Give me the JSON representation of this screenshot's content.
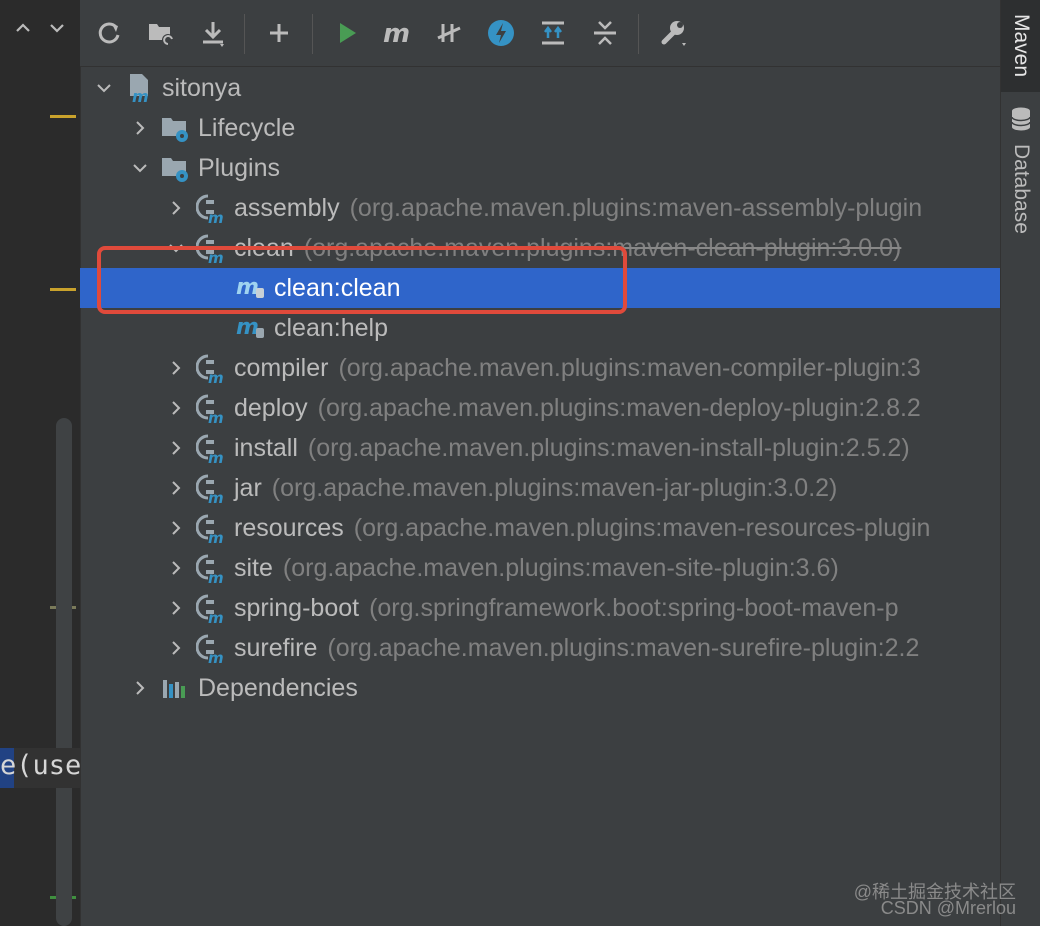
{
  "editor": {
    "code_fragment": "e(use",
    "nav_up_icon": "chevron-up-icon",
    "nav_down_icon": "chevron-down-icon"
  },
  "toolbar": {
    "buttons": [
      {
        "id": "reload",
        "icon": "reload-icon"
      },
      {
        "id": "generate-sources",
        "icon": "folder-refresh-icon"
      },
      {
        "id": "download",
        "icon": "download-icon"
      },
      {
        "id": "add",
        "icon": "plus-icon"
      },
      {
        "id": "run",
        "icon": "run-icon"
      },
      {
        "id": "execute-goal",
        "icon": "maven-m-icon"
      },
      {
        "id": "toggle-offline",
        "icon": "offline-toggle-icon"
      },
      {
        "id": "skip-tests",
        "icon": "lightning-icon"
      },
      {
        "id": "show-dependencies",
        "icon": "expand-all-icon"
      },
      {
        "id": "collapse-all",
        "icon": "collapse-all-icon"
      },
      {
        "id": "settings",
        "icon": "wrench-icon"
      }
    ]
  },
  "side_tabs": {
    "maven": "Maven",
    "database": "Database"
  },
  "tree": {
    "project": "sitonya",
    "lifecycle": "Lifecycle",
    "plugins": "Plugins",
    "plugin_items": [
      {
        "name": "assembly",
        "coord": "(org.apache.maven.plugins:maven-assembly-plugin"
      },
      {
        "name": "clean",
        "coord": "(org.apache.maven.plugins:maven-clean-plugin:3.0.0)"
      },
      {
        "name": "compiler",
        "coord": "(org.apache.maven.plugins:maven-compiler-plugin:3"
      },
      {
        "name": "deploy",
        "coord": "(org.apache.maven.plugins:maven-deploy-plugin:2.8.2"
      },
      {
        "name": "install",
        "coord": "(org.apache.maven.plugins:maven-install-plugin:2.5.2)"
      },
      {
        "name": "jar",
        "coord": "(org.apache.maven.plugins:maven-jar-plugin:3.0.2)"
      },
      {
        "name": "resources",
        "coord": "(org.apache.maven.plugins:maven-resources-plugin"
      },
      {
        "name": "site",
        "coord": "(org.apache.maven.plugins:maven-site-plugin:3.6)"
      },
      {
        "name": "spring-boot",
        "coord": "(org.springframework.boot:spring-boot-maven-p"
      },
      {
        "name": "surefire",
        "coord": "(org.apache.maven.plugins:maven-surefire-plugin:2.2"
      }
    ],
    "clean_goals": [
      "clean:clean",
      "clean:help"
    ],
    "dependencies": "Dependencies"
  },
  "watermark": {
    "line1": "@稀土掘金技术社区",
    "line2": "CSDN @Mrerlou"
  },
  "colors": {
    "selection": "#2f65ca",
    "highlight_box": "#e04a3b",
    "run_green": "#499c54",
    "maven_blue": "#3592c4"
  }
}
